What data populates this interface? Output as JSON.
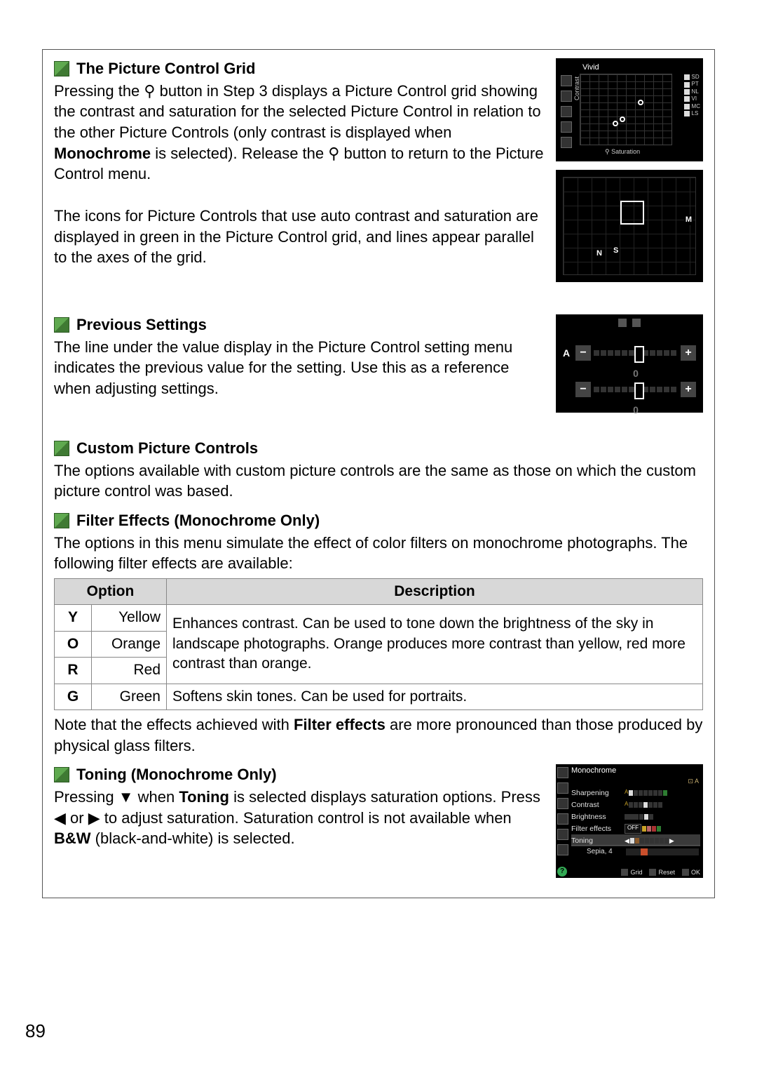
{
  "page_number": "89",
  "sections": {
    "grid": {
      "title": "The Picture Control Grid",
      "p1_a": "Pressing the ",
      "p1_b": " button in Step 3 displays a Picture Control grid showing the contrast and saturation for the selected Picture Control in relation to the other Picture Controls (only contrast is displayed when ",
      "mono": "Monochrome",
      "p1_c": " is selected).  Release the ",
      "p1_d": " button to return to the Picture Control menu.",
      "p2": "The icons for Picture Controls that use auto contrast and saturation are displayed in green in the Picture Control grid, and lines appear parallel to the axes of the grid.",
      "zoom_glyph": "⚲"
    },
    "prev": {
      "title": "Previous Settings",
      "p1": "The line under the value display in the Picture Control setting menu indicates the previous value for the setting.  Use this as a reference when adjusting settings."
    },
    "custom": {
      "title": "Custom Picture Controls",
      "p1": "The options available with custom picture controls are the same as those on which the custom picture control was based."
    },
    "filter": {
      "title": "Filter Effects (Monochrome Only)",
      "intro": "The options in this menu simulate the effect of color filters on monochrome photographs. The following filter effects are available:",
      "headers": {
        "option": "Option",
        "description": "Description"
      },
      "rows": [
        {
          "code": "Y",
          "name": "Yellow"
        },
        {
          "code": "O",
          "name": "Orange"
        },
        {
          "code": "R",
          "name": "Red"
        },
        {
          "code": "G",
          "name": "Green"
        }
      ],
      "desc_yor": "Enhances contrast.  Can be used to tone down the brightness of the sky in landscape photographs.  Orange produces more contrast than yellow, red more contrast than orange.",
      "desc_g": "Softens skin tones.  Can be used for portraits.",
      "note_a": "Note that the effects achieved with ",
      "note_b": "Filter effects",
      "note_c": " are more pronounced than those produced by physical glass filters."
    },
    "toning": {
      "title": "Toning (Monochrome Only)",
      "p_a": "Pressing ",
      "down": "▼",
      "p_b": " when ",
      "toning_word": "Toning",
      "p_c": " is selected displays saturation options. Press ",
      "left": "◀",
      "or": " or ",
      "right": "▶",
      "p_d": " to adjust saturation.  Saturation control is not available when ",
      "bw": "B&W",
      "p_e": " (black-and-white) is selected."
    }
  },
  "thumb1": {
    "title": "Vivid",
    "ylabel": "Contrast",
    "xlabel": "Saturation",
    "legend": [
      "SD",
      "PT",
      "NL",
      "VI",
      "MC",
      "LS"
    ],
    "zoom_glyph": "⚲"
  },
  "thumb2": {
    "letters": {
      "N": "N",
      "S": "S",
      "M": "M"
    }
  },
  "thumb3": {
    "A": "A",
    "minus": "−",
    "plus": "+",
    "zero": "0"
  },
  "thumb4": {
    "title": "Monochrome",
    "mode": "⊡ A",
    "rows": {
      "sharpening": "Sharpening",
      "contrast": "Contrast",
      "brightness": "Brightness",
      "filter": "Filter effects",
      "toning": "Toning"
    },
    "off": "OFF",
    "sepia": "Sepia, 4",
    "foot": {
      "grid": "Grid",
      "reset": "Reset",
      "ok": "OK"
    },
    "zoom_glyph": "⚲",
    "trash_glyph": "🗑",
    "ok_glyph": "OK"
  }
}
